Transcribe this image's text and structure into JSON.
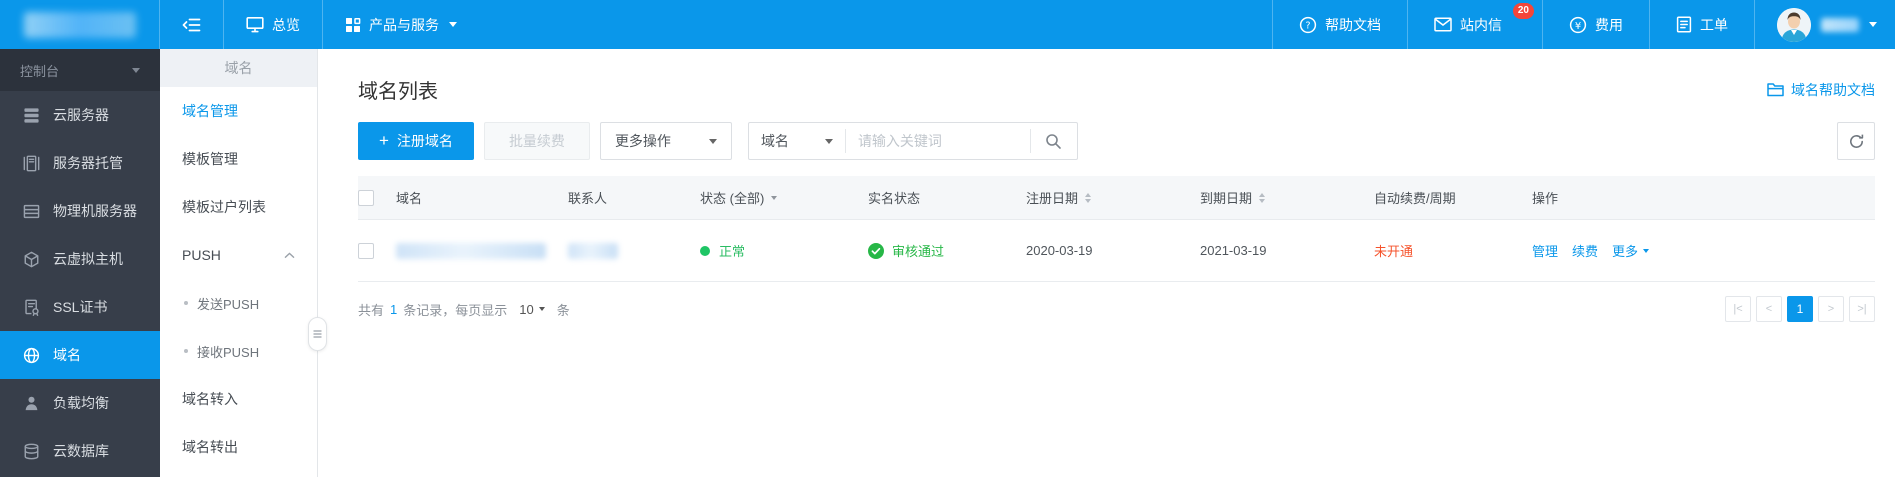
{
  "topbar": {
    "nav": {
      "overview": "总览",
      "products": "产品与服务"
    },
    "right": {
      "help": "帮助文档",
      "messages": "站内信",
      "messages_badge": "20",
      "billing": "费用",
      "tickets": "工单"
    }
  },
  "sidebar": {
    "console": "控制台",
    "items": [
      {
        "label": "云服务器",
        "icon": "cloud-server-icon"
      },
      {
        "label": "服务器托管",
        "icon": "server-hosting-icon"
      },
      {
        "label": "物理机服务器",
        "icon": "physical-server-icon"
      },
      {
        "label": "云虚拟主机",
        "icon": "virtual-host-icon"
      },
      {
        "label": "SSL证书",
        "icon": "ssl-certificate-icon"
      },
      {
        "label": "域名",
        "icon": "domain-globe-icon",
        "active": true
      },
      {
        "label": "负载均衡",
        "icon": "load-balancer-icon"
      },
      {
        "label": "云数据库",
        "icon": "cloud-database-icon"
      }
    ]
  },
  "subsidebar": {
    "header": "域名",
    "items": [
      {
        "label": "域名管理",
        "active": true
      },
      {
        "label": "模板管理"
      },
      {
        "label": "模板过户列表"
      },
      {
        "label": "PUSH",
        "group": true,
        "expanded": true
      },
      {
        "label": "发送PUSH",
        "sub": true
      },
      {
        "label": "接收PUSH",
        "sub": true
      },
      {
        "label": "域名转入"
      },
      {
        "label": "域名转出"
      }
    ]
  },
  "main": {
    "title": "域名列表",
    "help_link": "域名帮助文档",
    "toolbar": {
      "register": "注册域名",
      "batch_renew": "批量续费",
      "more_actions": "更多操作",
      "search_field": "域名",
      "search_placeholder": "请输入关键词"
    },
    "table": {
      "columns": [
        "域名",
        "联系人",
        "状态 (全部)",
        "实名状态",
        "注册日期",
        "到期日期",
        "自动续费/周期",
        "操作"
      ],
      "row": {
        "status": "正常",
        "realname_status": "审核通过",
        "register_date": "2020-03-19",
        "expire_date": "2021-03-19",
        "auto_renew": "未开通",
        "ops": [
          "管理",
          "续费",
          "更多"
        ]
      }
    },
    "pagination": {
      "total_prefix": "共有",
      "total_count": "1",
      "total_mid": "条记录，每页显示",
      "page_size": "10",
      "total_suffix": "条",
      "first": "|<",
      "prev": "<",
      "current_page": "1",
      "next": ">",
      "last": ">|"
    }
  },
  "colors": {
    "primary": "#0a97ea",
    "sidebar_bg": "#373e4a",
    "success_green": "#27b747",
    "status_green": "#1ec565",
    "warning_orange": "#f5532c",
    "badge_red": "#f4463a"
  }
}
